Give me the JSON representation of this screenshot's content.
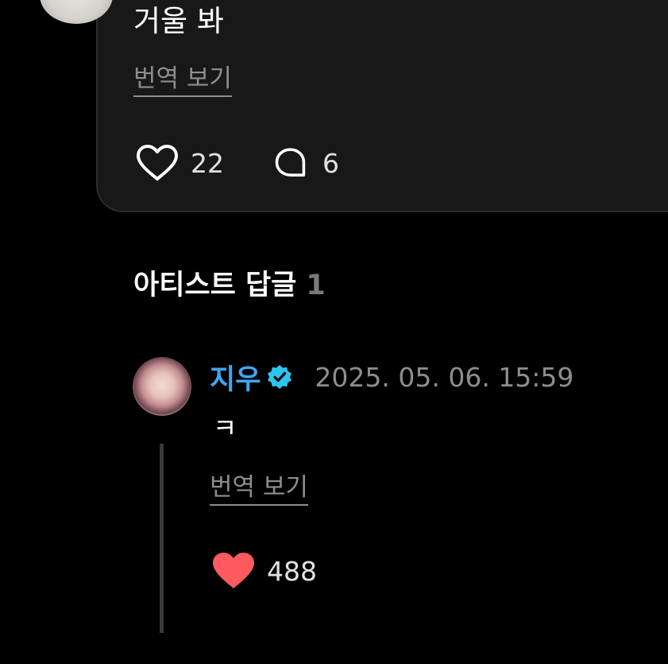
{
  "post": {
    "text": "거울 봐",
    "translate_label": "번역 보기",
    "like_count": "22",
    "comment_count": "6"
  },
  "section": {
    "title": "아티스트 답글",
    "count": "1"
  },
  "reply": {
    "author": "지우",
    "timestamp": "2025. 05. 06. 15:59",
    "text": "ㅋ",
    "translate_label": "번역 보기",
    "like_count": "488"
  },
  "colors": {
    "background": "#000000",
    "card": "#181818",
    "artist_name": "#3fa7f5",
    "verified_badge": "#2ec4f0",
    "liked_heart": "#ff5a5f",
    "muted_text": "#8e8e8e"
  },
  "icons": {
    "like": "heart-outline-icon",
    "comment": "speech-bubble-icon",
    "verified": "verified-badge-icon",
    "reply_like": "heart-filled-icon"
  }
}
